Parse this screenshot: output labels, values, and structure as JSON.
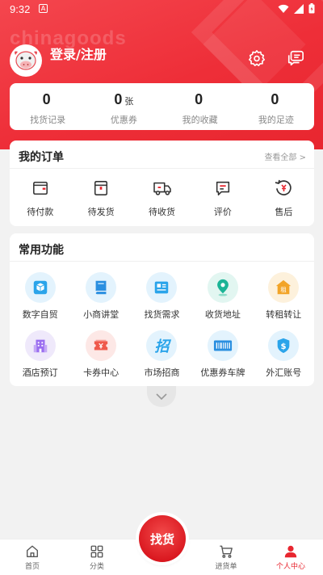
{
  "status_bar": {
    "time": "9:32",
    "notif_letter": "A"
  },
  "header": {
    "watermark": "chinagoods",
    "login_label": "登录/注册"
  },
  "stats": [
    {
      "value": "0",
      "unit": "",
      "label": "找货记录"
    },
    {
      "value": "0",
      "unit": "张",
      "label": "优惠券"
    },
    {
      "value": "0",
      "unit": "",
      "label": "我的收藏"
    },
    {
      "value": "0",
      "unit": "",
      "label": "我的足迹"
    }
  ],
  "orders": {
    "title": "我的订单",
    "view_all": "查看全部 >",
    "items": [
      {
        "label": "待付款",
        "icon": "wallet-icon"
      },
      {
        "label": "待发货",
        "icon": "package-icon"
      },
      {
        "label": "待收货",
        "icon": "truck-icon"
      },
      {
        "label": "评价",
        "icon": "comment-icon"
      },
      {
        "label": "售后",
        "icon": "refund-icon"
      }
    ]
  },
  "functions": {
    "title": "常用功能",
    "items": [
      {
        "label": "数字自贸",
        "icon": "cube-icon",
        "bg": "#e3f3fd",
        "fg": "#2aa4ea"
      },
      {
        "label": "小商讲堂",
        "icon": "book-icon",
        "bg": "#e3f3fd",
        "fg": "#2a8fe0"
      },
      {
        "label": "找货需求",
        "icon": "document-icon",
        "bg": "#e3f3fd",
        "fg": "#2aa4ea"
      },
      {
        "label": "收货地址",
        "icon": "location-icon",
        "bg": "#e2f6f1",
        "fg": "#1bb496"
      },
      {
        "label": "转租转让",
        "icon": "shop-icon",
        "bg": "#fdf1dc",
        "fg": "#f2a428"
      },
      {
        "label": "酒店预订",
        "icon": "hotel-icon",
        "bg": "#efe9fb",
        "fg": "#9a6ef0"
      },
      {
        "label": "卡券中心",
        "icon": "ticket-icon",
        "bg": "#fde8e6",
        "fg": "#ef5a4c"
      },
      {
        "label": "市场招商",
        "icon": "recruit-icon",
        "bg": "#e3f3fd",
        "fg": "#2aa4ea"
      },
      {
        "label": "优惠券车牌",
        "icon": "barcode-icon",
        "bg": "#e3f3fd",
        "fg": "#2a8fe0"
      },
      {
        "label": "外汇账号",
        "icon": "dollar-icon",
        "bg": "#e3f3fd",
        "fg": "#2aa4ea"
      }
    ],
    "recruit_glyph": "招",
    "hotel_glyph": "租"
  },
  "tabbar": {
    "tabs": [
      {
        "label": "首页",
        "active": false
      },
      {
        "label": "分类",
        "active": false
      },
      {
        "label": "",
        "active": false
      },
      {
        "label": "进货单",
        "active": false
      },
      {
        "label": "个人中心",
        "active": true
      }
    ],
    "center_label": "找货"
  },
  "colors": {
    "brand": "#e8262f",
    "accent": "#ee2e38"
  }
}
